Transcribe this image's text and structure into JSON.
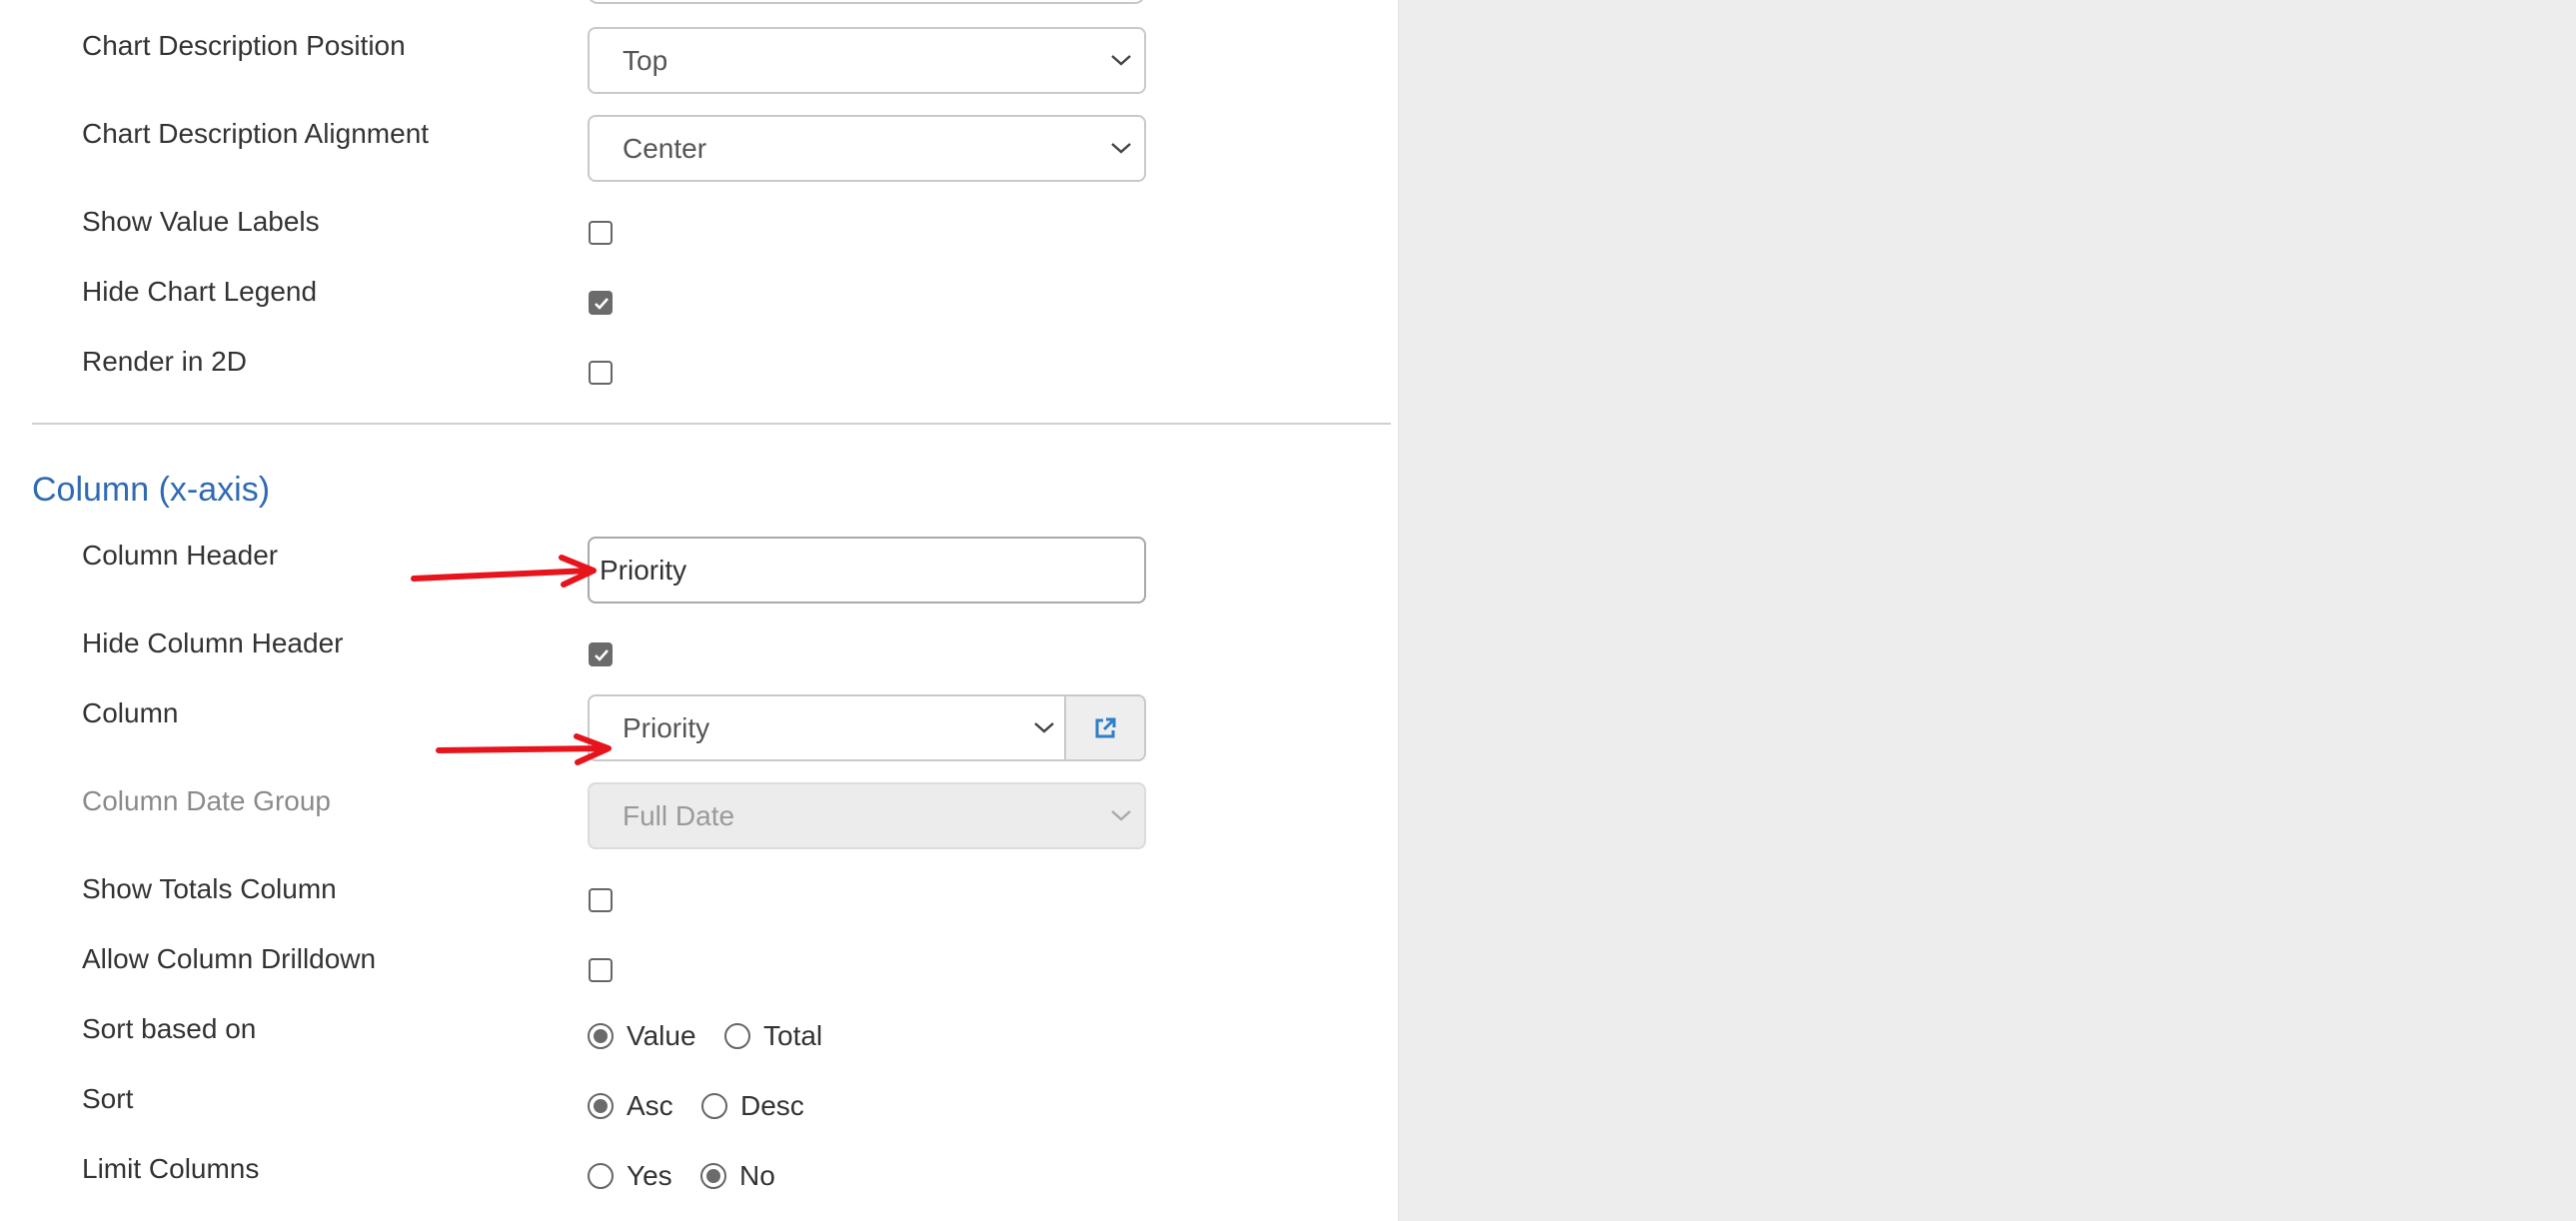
{
  "chart_settings": {
    "description_position": {
      "label": "Chart Description Position",
      "value": "Top"
    },
    "description_alignment": {
      "label": "Chart Description Alignment",
      "value": "Center"
    },
    "show_value_labels": {
      "label": "Show Value Labels",
      "checked": false
    },
    "hide_chart_legend": {
      "label": "Hide Chart Legend",
      "checked": true
    },
    "render_2d": {
      "label": "Render in 2D",
      "checked": false
    }
  },
  "column_section": {
    "title": "Column (x-axis)",
    "column_header": {
      "label": "Column Header",
      "value": "Priority"
    },
    "hide_column_header": {
      "label": "Hide Column Header",
      "checked": true
    },
    "column": {
      "label": "Column",
      "value": "Priority"
    },
    "column_date_group": {
      "label": "Column Date Group",
      "value": "Full Date",
      "disabled": true
    },
    "show_totals_column": {
      "label": "Show Totals Column",
      "checked": false
    },
    "allow_column_drilldown": {
      "label": "Allow Column Drilldown",
      "checked": false
    },
    "sort_based_on": {
      "label": "Sort based on",
      "options": [
        "Value",
        "Total"
      ],
      "selected": "Value"
    },
    "sort": {
      "label": "Sort",
      "options": [
        "Asc",
        "Desc"
      ],
      "selected": "Asc"
    },
    "limit_columns": {
      "label": "Limit Columns",
      "options": [
        "Yes",
        "No"
      ],
      "selected": "No"
    }
  },
  "annotations": {
    "arrow_color": "#e8141c"
  },
  "colors": {
    "section_title": "#2f6ab3",
    "background": "#ededed",
    "panel": "#ffffff"
  },
  "icons": {
    "select_chevron": "chevron-down-icon",
    "edit_column": "external-link-icon"
  }
}
